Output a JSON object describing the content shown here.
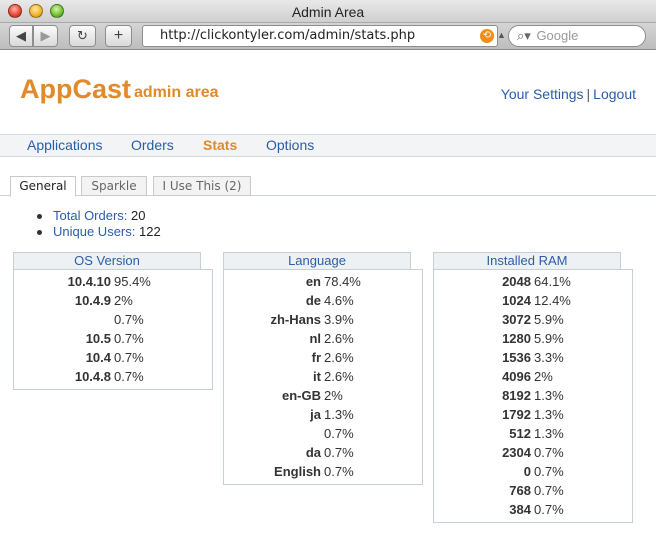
{
  "window": {
    "title": "Admin Area"
  },
  "toolbar": {
    "back": "◀",
    "forward": "▶",
    "reload": "↻",
    "add": "+",
    "url": "http://clickontyler.com/admin/stats.php",
    "search_placeholder": "Google"
  },
  "header": {
    "brand": "AppCast",
    "subtitle": "admin area",
    "settings_link": "Your Settings",
    "separator": "|",
    "logout_link": "Logout"
  },
  "nav": {
    "items": [
      {
        "label": "Applications"
      },
      {
        "label": "Orders"
      },
      {
        "label": "Stats"
      },
      {
        "label": "Options"
      }
    ],
    "active": "Stats"
  },
  "tabs": [
    {
      "label": "General"
    },
    {
      "label": "Sparkle"
    },
    {
      "label": "I Use This (2)"
    }
  ],
  "summary": {
    "total_orders_label": "Total Orders:",
    "total_orders_value": "20",
    "unique_users_label": "Unique Users:",
    "unique_users_value": "122"
  },
  "panels": [
    {
      "title": "OS Version",
      "rows": [
        {
          "label": "10.4.10",
          "value": "95.4%"
        },
        {
          "label": "10.4.9",
          "value": "2%"
        },
        {
          "label": "",
          "value": "0.7%"
        },
        {
          "label": "10.5",
          "value": "0.7%"
        },
        {
          "label": "10.4",
          "value": "0.7%"
        },
        {
          "label": "10.4.8",
          "value": "0.7%"
        }
      ]
    },
    {
      "title": "Language",
      "rows": [
        {
          "label": "en",
          "value": "78.4%"
        },
        {
          "label": "de",
          "value": "4.6%"
        },
        {
          "label": "zh-Hans",
          "value": "3.9%"
        },
        {
          "label": "nl",
          "value": "2.6%"
        },
        {
          "label": "fr",
          "value": "2.6%"
        },
        {
          "label": "it",
          "value": "2.6%"
        },
        {
          "label": "en-GB",
          "value": "2%"
        },
        {
          "label": "ja",
          "value": "1.3%"
        },
        {
          "label": "",
          "value": "0.7%"
        },
        {
          "label": "da",
          "value": "0.7%"
        },
        {
          "label": "English",
          "value": "0.7%"
        }
      ]
    },
    {
      "title": "Installed RAM",
      "rows": [
        {
          "label": "2048",
          "value": "64.1%"
        },
        {
          "label": "1024",
          "value": "12.4%"
        },
        {
          "label": "3072",
          "value": "5.9%"
        },
        {
          "label": "1280",
          "value": "5.9%"
        },
        {
          "label": "1536",
          "value": "3.3%"
        },
        {
          "label": "4096",
          "value": "2%"
        },
        {
          "label": "8192",
          "value": "1.3%"
        },
        {
          "label": "1792",
          "value": "1.3%"
        },
        {
          "label": "512",
          "value": "1.3%"
        },
        {
          "label": "2304",
          "value": "0.7%"
        },
        {
          "label": "0",
          "value": "0.7%"
        },
        {
          "label": "768",
          "value": "0.7%"
        },
        {
          "label": "384",
          "value": "0.7%"
        }
      ]
    }
  ],
  "colors": {
    "brand": "#e08a2c",
    "link": "#2a5da8"
  }
}
